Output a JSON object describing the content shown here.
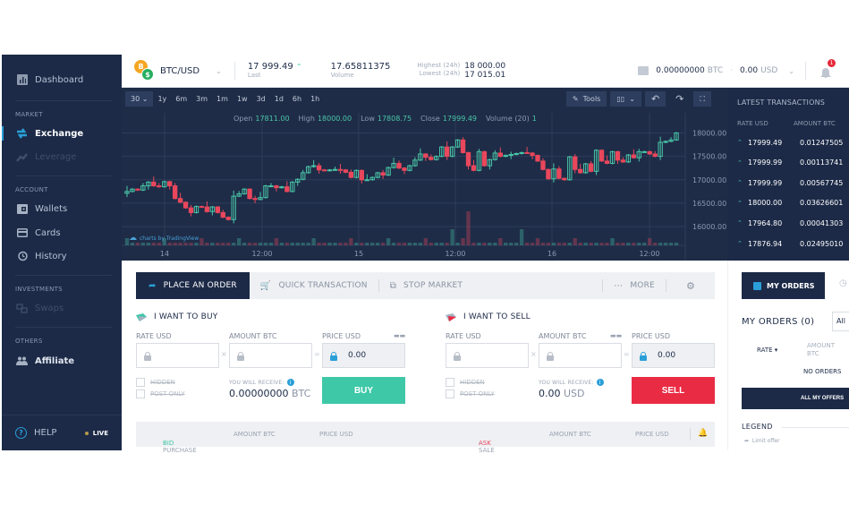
{
  "sidebar": {
    "items": {
      "dashboard": "Dashboard",
      "exchange": "Exchange",
      "leverage": "Leverage",
      "wallets": "Wallets",
      "cards": "Cards",
      "history": "History",
      "swaps": "Swaps",
      "affiliate": "Affiliate"
    },
    "sections": {
      "market": "MARKET",
      "account": "ACCOUNT",
      "investments": "INVESTMENTS",
      "others": "OTHERS"
    },
    "help": "HELP",
    "live": "LIVE"
  },
  "topbar": {
    "pair": "BTC/USD",
    "last_value": "17 999.49",
    "last_label": "Last",
    "volume_value": "17.65811375",
    "volume_label": "Volume",
    "high_label": "Highest (24h)",
    "high_value": "18 000.00",
    "low_label": "Lowest (24h)",
    "low_value": "17 015.01",
    "wallet_btc": "0.00000000",
    "wallet_btc_unit": "BTC",
    "wallet_usd": "0.00",
    "wallet_usd_unit": "USD",
    "notifications": "1"
  },
  "chart": {
    "interval": "30",
    "timeframes": [
      "1y",
      "6m",
      "3m",
      "1m",
      "1w",
      "3d",
      "1d",
      "6h",
      "1h"
    ],
    "tools_label": "Tools",
    "ohlc": {
      "open_label": "Open",
      "open": "17811.00",
      "high_label": "High",
      "high": "18000.00",
      "low_label": "Low",
      "low": "17808.75",
      "close_label": "Close",
      "close": "17999.49",
      "volume_label": "Volume (20)",
      "volume": "1"
    },
    "watermark": "charts by TradingView"
  },
  "chart_data": {
    "type": "candlestick",
    "title": "BTC/USD",
    "y_ticks": [
      "18000.00",
      "17500.00",
      "17000.00",
      "16500.00",
      "16000.00"
    ],
    "ylim": [
      15600,
      18200
    ],
    "x_ticks": [
      "14",
      "12:00",
      "15",
      "12:00",
      "16",
      "12:00"
    ],
    "colors": {
      "up": "#4ac6a8",
      "down": "#e9475c"
    },
    "candles_close": [
      16750,
      16800,
      16780,
      16870,
      16950,
      16870,
      16850,
      16960,
      16870,
      16600,
      16520,
      16400,
      16300,
      16430,
      16420,
      16320,
      16420,
      16300,
      16200,
      16150,
      16650,
      16700,
      16800,
      16600,
      16580,
      16620,
      16870,
      16870,
      16830,
      16850,
      16750,
      16950,
      17010,
      17150,
      17280,
      17300,
      17210,
      17200,
      17210,
      17220,
      17210,
      17160,
      17050,
      17200,
      17000,
      17000,
      17050,
      17150,
      17100,
      17260,
      17350,
      17250,
      17200,
      17300,
      17420,
      17550,
      17480,
      17430,
      17500,
      17700,
      17500,
      17700,
      17850,
      17580,
      17300,
      17200,
      17600,
      17300,
      17430,
      17570,
      17500,
      17520,
      17540,
      17560,
      17580,
      17570,
      17520,
      17400,
      17220,
      17020,
      17230,
      17030,
      17000,
      17490,
      17220,
      17150,
      17340,
      17180,
      17630,
      17400,
      17350,
      17600,
      17420,
      17380,
      17530,
      17470,
      17600,
      17600,
      17550,
      17500,
      17800,
      17820,
      17850,
      18000
    ]
  },
  "latest_transactions": {
    "title": "LATEST TRANSACTIONS",
    "col_rate": "RATE USD",
    "col_amount": "AMOUNT BTC",
    "rows": [
      {
        "rate": "17999.49",
        "amount": "0.01247505"
      },
      {
        "rate": "17999.99",
        "amount": "0.00113741"
      },
      {
        "rate": "17999.99",
        "amount": "0.00567745"
      },
      {
        "rate": "18000.00",
        "amount": "0.03626601"
      },
      {
        "rate": "17964.80",
        "amount": "0.00041303"
      },
      {
        "rate": "17876.94",
        "amount": "0.02495010"
      }
    ]
  },
  "order": {
    "tabs": {
      "place": "PLACE AN ORDER",
      "quick": "QUICK TRANSACTION",
      "stop": "STOP MARKET",
      "more": "MORE"
    },
    "buy": {
      "title": "I WANT TO BUY",
      "rate_label": "RATE USD",
      "amount_label": "AMOUNT BTC",
      "price_label": "PRICE USD",
      "price_value": "0.00",
      "hidden": "HIDDEN",
      "post_only": "POST ONLY",
      "receive_label": "YOU WILL RECEIVE:",
      "receive_value": "0.00000000",
      "receive_unit": "BTC",
      "button": "BUY"
    },
    "sell": {
      "title": "I WANT TO SELL",
      "rate_label": "RATE USD",
      "amount_label": "AMOUNT BTC",
      "price_label": "PRICE USD",
      "price_value": "0.00",
      "hidden": "HIDDEN",
      "post_only": "POST ONLY",
      "receive_label": "YOU WILL RECEIVE:",
      "receive_value": "0.00",
      "receive_unit": "USD",
      "button": "SELL"
    },
    "book": {
      "bid": "BID",
      "bid_rest": " - PURCHASE",
      "bid_amount": "AMOUNT BTC",
      "bid_price": "PRICE USD",
      "ask": "ASK",
      "ask_rest": "- SALE",
      "ask_amount": "AMOUNT BTC",
      "ask_price": "PRICE USD"
    },
    "colors": {
      "buy": "#3ec8a8",
      "sell": "#ea2b44"
    }
  },
  "my_orders": {
    "tab": "MY ORDERS",
    "title": "MY ORDERS (0)",
    "filter": "All",
    "col_rate": "RATE",
    "col_amount": "AMOUNT BTC",
    "empty": "NO ORDERS",
    "all_offers": "ALL MY OFFERS",
    "legend": "LEGEND",
    "legend_item": "Limit offer"
  }
}
